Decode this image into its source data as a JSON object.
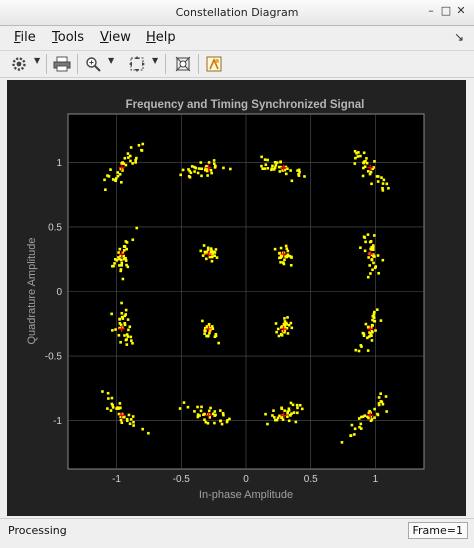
{
  "window": {
    "title": "Constellation Diagram"
  },
  "menu": [
    {
      "label": "File",
      "key": "F"
    },
    {
      "label": "Tools",
      "key": "T"
    },
    {
      "label": "View",
      "key": "V"
    },
    {
      "label": "Help",
      "key": "H"
    }
  ],
  "toolbar": [
    "settings-icon",
    "print-icon",
    "zoom-in-icon",
    "pan-icon",
    "autoscale-icon",
    "highlight-icon"
  ],
  "colors": {
    "axes_bg": "#000000",
    "panel_bg": "#222222",
    "points": "#ffff00",
    "reference": "#ff0000",
    "grid": "#555555",
    "title": "#b5b5b5",
    "tick": "#d0d0d0"
  },
  "status": {
    "left": "Processing",
    "right": "Frame=1"
  },
  "chart_data": {
    "type": "scatter",
    "title": "Frequency and Timing Synchronized Signal",
    "xlabel": "In-phase Amplitude",
    "ylabel": "Quadrature Amplitude",
    "xlim": [
      -1.375,
      1.375
    ],
    "ylim": [
      -1.375,
      1.375
    ],
    "xticks": [
      -1,
      -0.5,
      0,
      0.5,
      1
    ],
    "yticks": [
      -1,
      -0.5,
      0,
      0.5,
      1
    ],
    "xtick_labels": [
      "-1",
      "-0.5",
      "0",
      "0.5",
      "1"
    ],
    "ytick_labels": [
      "-1",
      "-0.5",
      "0",
      "0.5",
      "1"
    ],
    "grid": true,
    "reference_points": [
      [
        0.29,
        0.96
      ],
      [
        0.96,
        0.96
      ],
      [
        -0.29,
        0.96
      ],
      [
        -0.96,
        0.96
      ],
      [
        0.29,
        -0.96
      ],
      [
        0.96,
        -0.96
      ],
      [
        -0.29,
        -0.96
      ],
      [
        -0.96,
        -0.96
      ],
      [
        0.96,
        0.29
      ],
      [
        -0.96,
        0.29
      ],
      [
        0.96,
        -0.29
      ],
      [
        -0.96,
        -0.29
      ],
      [
        0.29,
        0.29
      ],
      [
        -0.29,
        0.29
      ],
      [
        0.29,
        -0.29
      ],
      [
        -0.29,
        -0.29
      ]
    ],
    "clusters": [
      {
        "center": [
          0.29,
          0.96
        ],
        "spread": "tangential"
      },
      {
        "center": [
          0.96,
          0.96
        ],
        "spread": "tangential"
      },
      {
        "center": [
          -0.29,
          0.96
        ],
        "spread": "tangential"
      },
      {
        "center": [
          -0.96,
          0.96
        ],
        "spread": "tangential"
      },
      {
        "center": [
          0.29,
          -0.96
        ],
        "spread": "tangential"
      },
      {
        "center": [
          0.96,
          -0.96
        ],
        "spread": "tangential"
      },
      {
        "center": [
          -0.29,
          -0.96
        ],
        "spread": "tangential"
      },
      {
        "center": [
          -0.96,
          -0.96
        ],
        "spread": "tangential"
      },
      {
        "center": [
          0.96,
          0.29
        ],
        "spread": "tangential"
      },
      {
        "center": [
          -0.96,
          0.29
        ],
        "spread": "tangential"
      },
      {
        "center": [
          0.96,
          -0.29
        ],
        "spread": "tangential"
      },
      {
        "center": [
          -0.96,
          -0.29
        ],
        "spread": "tangential"
      },
      {
        "center": [
          0.29,
          0.29
        ],
        "spread": "tangential"
      },
      {
        "center": [
          -0.29,
          0.29
        ],
        "spread": "tangential"
      },
      {
        "center": [
          0.29,
          -0.29
        ],
        "spread": "tangential"
      },
      {
        "center": [
          -0.29,
          -0.29
        ],
        "spread": "tangential"
      }
    ]
  }
}
